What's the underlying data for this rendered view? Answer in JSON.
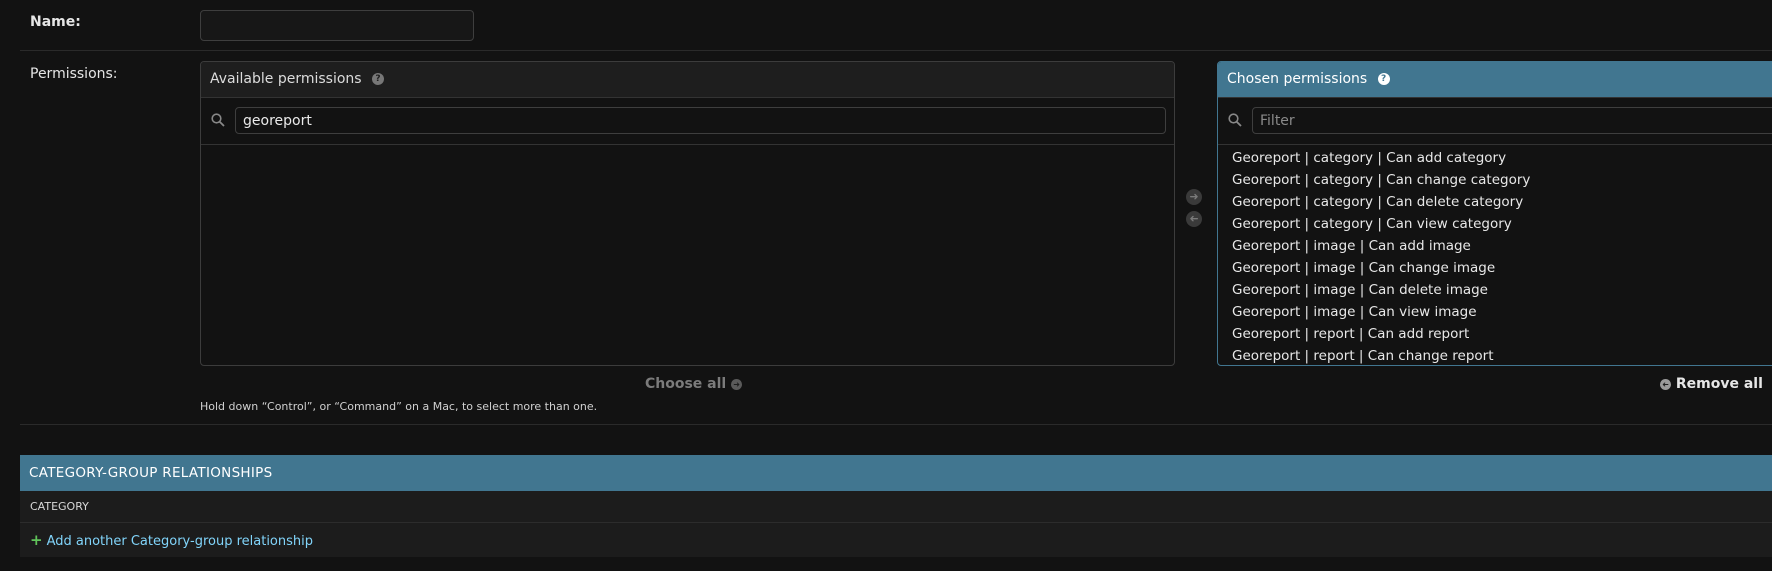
{
  "name_field": {
    "label": "Name:",
    "value": ""
  },
  "permissions": {
    "label": "Permissions:",
    "available": {
      "title": "Available permissions",
      "filter_value": "georeport",
      "items": []
    },
    "chosen": {
      "title": "Chosen permissions",
      "filter_placeholder": "Filter",
      "items": [
        "Georeport | category | Can add category",
        "Georeport | category | Can change category",
        "Georeport | category | Can delete category",
        "Georeport | category | Can view category",
        "Georeport | image | Can add image",
        "Georeport | image | Can change image",
        "Georeport | image | Can delete image",
        "Georeport | image | Can view image",
        "Georeport | report | Can add report",
        "Georeport | report | Can change report"
      ]
    },
    "choose_all": "Choose all",
    "remove_all": "Remove all",
    "help_text": "Hold down “Control”, or “Command” on a Mac, to select more than one."
  },
  "inline_group": {
    "title": "CATEGORY-GROUP RELATIONSHIPS",
    "column_header": "CATEGORY",
    "add_link": "Add another Category-group relationship"
  },
  "icons": {
    "help": "question-circle-icon",
    "search": "search-icon",
    "add": "plus-icon",
    "arrow_right": "arrow-right-circle-icon",
    "arrow_left": "arrow-left-circle-icon"
  },
  "colors": {
    "header_blue": "#417690",
    "link_blue": "#81d4fa",
    "add_green": "#60c35a",
    "background": "#121212"
  }
}
